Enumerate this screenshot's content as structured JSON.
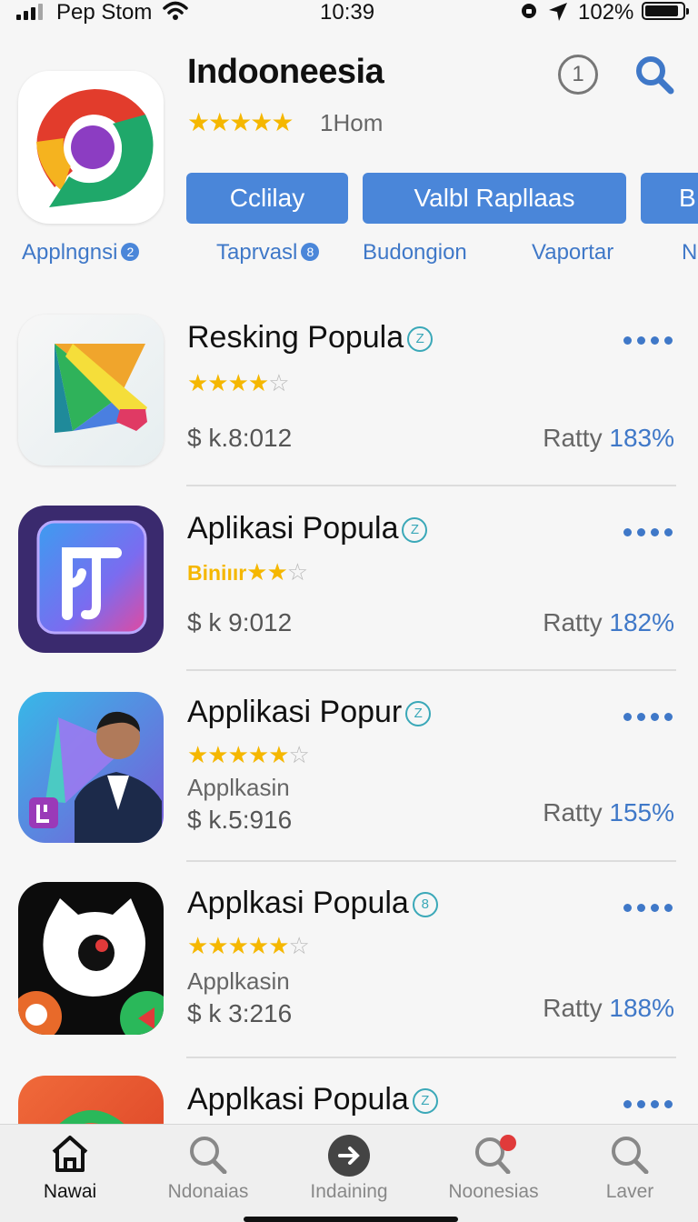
{
  "status_bar": {
    "carrier": "Pep Stom",
    "time": "10:39",
    "battery": "102%"
  },
  "header": {
    "app_name": "Indooneesia",
    "stars": "★★★★★",
    "rating_count": "1Hom",
    "info_label": "1",
    "buttons": [
      "Cclilay",
      "Valbl Rapllaas",
      "B"
    ],
    "categories": [
      {
        "label": "Applngnsi",
        "badge": "2"
      },
      {
        "label": "Taprvasl",
        "badge": "8"
      },
      {
        "label": "Budongion",
        "badge": ""
      },
      {
        "label": "Vaportar",
        "badge": ""
      },
      {
        "label": "N",
        "badge": ""
      }
    ]
  },
  "apps": [
    {
      "title": "Resking Popula",
      "badge": "Z",
      "stars": "★★★★",
      "empty_stars": "☆",
      "stars_word": "",
      "subtitle": "",
      "price": "$ k.8:012",
      "rating_label": "Ratty",
      "rating_value": "183%"
    },
    {
      "title": "Aplikasi Popula",
      "badge": "Z",
      "stars": "★★",
      "empty_stars": "☆",
      "stars_word": "Biniıır",
      "subtitle": "",
      "price": "$ k 9:012",
      "rating_label": "Ratty",
      "rating_value": "182%"
    },
    {
      "title": "Applikasi Popur",
      "badge": "Z",
      "stars": "★★★★★",
      "empty_stars": "☆",
      "stars_word": "",
      "subtitle": "Applkasin",
      "price": "$ k.5:916",
      "rating_label": "Ratty",
      "rating_value": "155%"
    },
    {
      "title": "Applkasi Popula",
      "badge": "8",
      "stars": "★★★★★",
      "empty_stars": "☆",
      "stars_word": "",
      "subtitle": "Applkasin",
      "price": "$ k 3:216",
      "rating_label": "Ratty",
      "rating_value": "188%"
    },
    {
      "title": "Applkasi Popula",
      "badge": "Z",
      "stars": "",
      "empty_stars": "",
      "stars_word": "",
      "subtitle": "",
      "price": "",
      "rating_label": "",
      "rating_value": ""
    }
  ],
  "tabs": [
    {
      "label": "Nawai",
      "icon": "home-icon",
      "active": true
    },
    {
      "label": "Ndonaias",
      "icon": "search-icon",
      "active": false
    },
    {
      "label": "Indaining",
      "icon": "arrow-circle-icon",
      "active": false
    },
    {
      "label": "Noonesias",
      "icon": "search-icon",
      "active": false,
      "badge": "G"
    },
    {
      "label": "Laver",
      "icon": "search-icon",
      "active": false
    }
  ],
  "colors": {
    "accent": "#4a86d9",
    "link": "#3f78c8",
    "star": "#f5b700",
    "background": "#f6f6f6"
  }
}
